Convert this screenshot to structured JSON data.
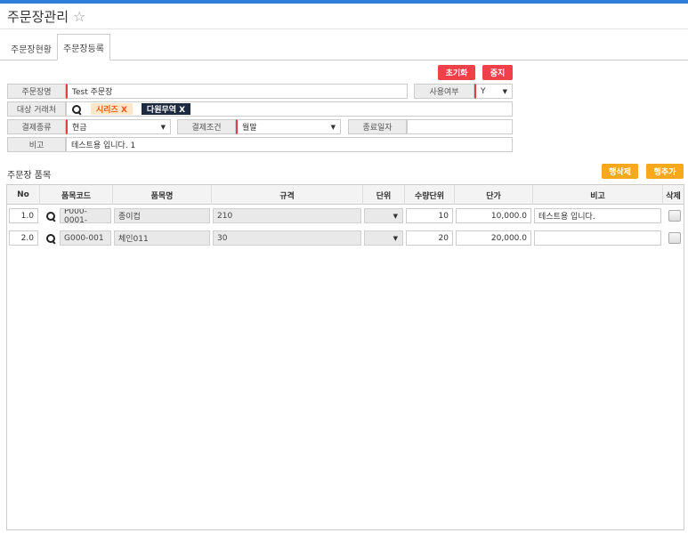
{
  "page": {
    "title": "주문장관리"
  },
  "tabs": [
    {
      "label": "주문장현황",
      "active": false
    },
    {
      "label": "주문장등록",
      "active": true
    }
  ],
  "actions": {
    "reset_label": "초기화",
    "stop_label": "중지"
  },
  "form": {
    "order_name_label": "주문장명",
    "order_name_value": "Test 주문장",
    "use_label": "사용여부",
    "use_value": "Y",
    "partner_label": "대상 거래처",
    "partner_tags": [
      "시리즈 X",
      "다원무역 X"
    ],
    "payment_type_label": "결제종류",
    "payment_type_value": "현금",
    "payment_terms_label": "결제조건",
    "payment_terms_value": "월말",
    "end_date_label": "종료일자",
    "end_date_value": "",
    "note_label": "비고",
    "note_value": "테스트용 입니다. 1"
  },
  "items": {
    "title": "주문장 품목",
    "delete_row_label": "행삭제",
    "add_row_label": "행추가",
    "headers": {
      "no": "No",
      "code": "품목코드",
      "name": "품목명",
      "spec": "규격",
      "unit": "단위",
      "qty_unit": "수량단위",
      "price": "단가",
      "note": "비고",
      "delete": "삭제"
    },
    "rows": [
      {
        "no": "1.0",
        "code": "P000-0001-",
        "name": "종이컵",
        "spec": "210",
        "unit": "",
        "qty_unit": "10",
        "price": "10,000.0",
        "note": "테스트용 입니다."
      },
      {
        "no": "2.0",
        "code": "G000-001",
        "name": "체인011",
        "spec": "30",
        "unit": "",
        "qty_unit": "20",
        "price": "20,000.0",
        "note": ""
      }
    ]
  },
  "colors": {
    "accent": "#2f7fd8",
    "danger": "#f2404a",
    "warning": "#f8a81b",
    "required": "#e83a47"
  }
}
